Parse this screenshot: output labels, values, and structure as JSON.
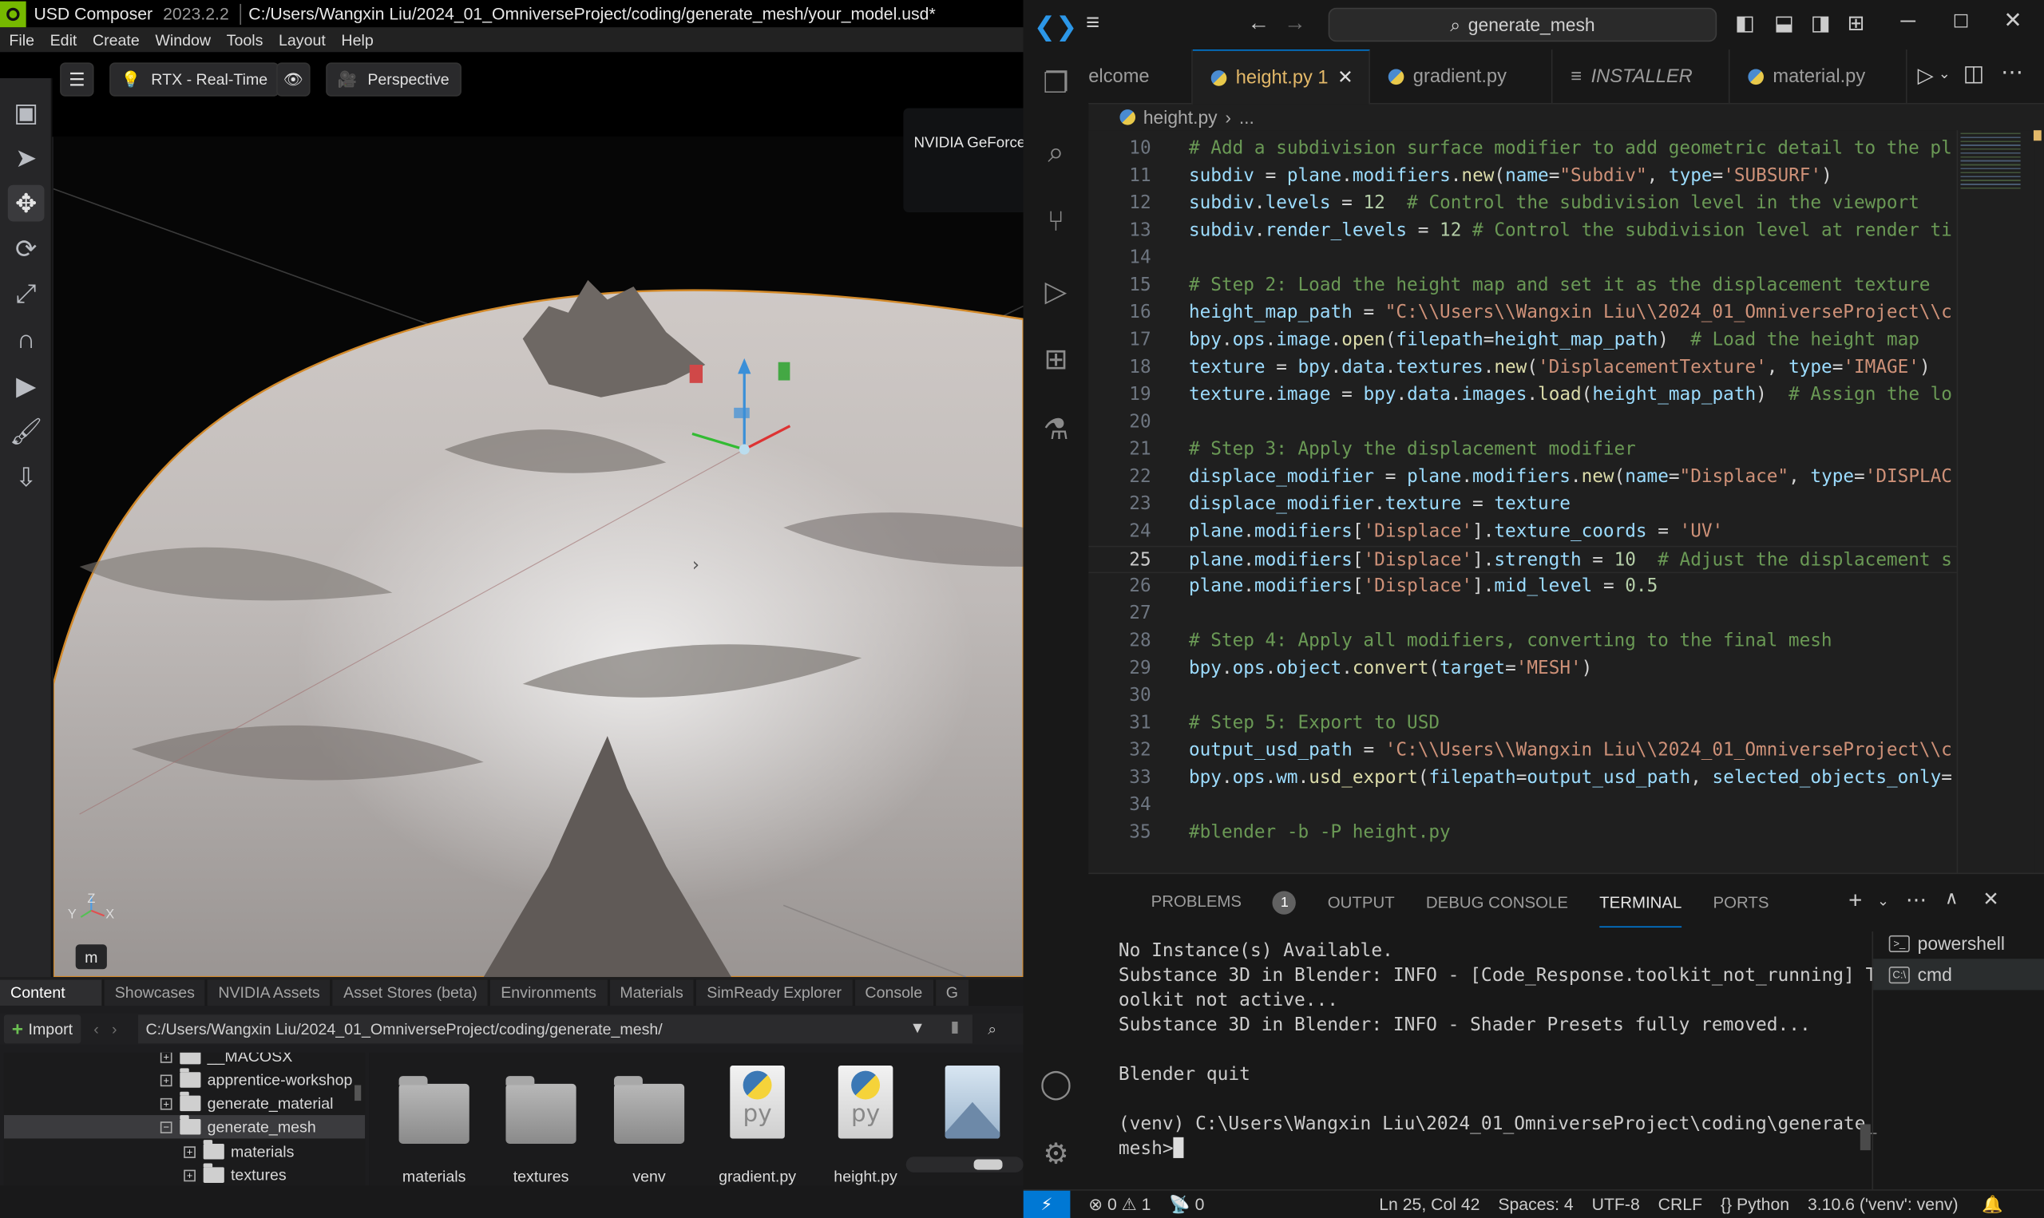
{
  "usd": {
    "app_name": "USD Composer",
    "version": "2023.2.2",
    "file_path": "C:/Users/Wangxin Liu/2024_01_OmniverseProject/coding/generate_mesh/your_model.usd*",
    "menu": [
      "File",
      "Edit",
      "Create",
      "Window",
      "Tools",
      "Layout",
      "Help"
    ],
    "viewport": {
      "render_mode": "RTX - Real-Time",
      "camera": "Perspective",
      "gpu_label": "NVIDIA GeForce",
      "axis_labels": {
        "y": "Y",
        "z": "Z",
        "x": "X"
      },
      "m_button": "m"
    },
    "content_tabs": [
      "Content",
      "Showcases",
      "NVIDIA Assets",
      "Asset Stores (beta)",
      "Environments",
      "Materials",
      "SimReady Explorer",
      "Console",
      "G"
    ],
    "import_label": "Import",
    "content_path": "C:/Users/Wangxin Liu/2024_01_OmniverseProject/coding/generate_mesh/",
    "tree": [
      {
        "label": "__MACOSX",
        "level": 1
      },
      {
        "label": "apprentice-workshop",
        "level": 1
      },
      {
        "label": "generate_material",
        "level": 1
      },
      {
        "label": "generate_mesh",
        "level": 1,
        "selected": true,
        "expanded": true
      },
      {
        "label": "materials",
        "level": 2
      },
      {
        "label": "textures",
        "level": 2
      }
    ],
    "files": [
      {
        "name": "materials",
        "kind": "folder"
      },
      {
        "name": "textures",
        "kind": "folder"
      },
      {
        "name": "venv",
        "kind": "folder"
      },
      {
        "name": "gradient.py",
        "kind": "python"
      },
      {
        "name": "height.py",
        "kind": "python"
      },
      {
        "name": "",
        "kind": "image"
      }
    ],
    "py_glyph": "py"
  },
  "vscode": {
    "search": "generate_mesh",
    "tabs": [
      {
        "label": "elcome",
        "kind": "welcome"
      },
      {
        "label": "height.py",
        "kind": "python",
        "active": true,
        "problems": "1"
      },
      {
        "label": "gradient.py",
        "kind": "python"
      },
      {
        "label": "INSTALLER",
        "kind": "text"
      },
      {
        "label": "material.py",
        "kind": "python"
      }
    ],
    "breadcrumb": {
      "file": "height.py",
      "rest": "..."
    },
    "current_line": 25,
    "code": [
      {
        "n": "10",
        "t": [
          [
            "cmt",
            "# Add a subdivision surface modifier to add geometric detail to the pl"
          ]
        ]
      },
      {
        "n": "11",
        "t": [
          [
            "var",
            "subdiv"
          ],
          [
            "op",
            " = "
          ],
          [
            "var",
            "plane"
          ],
          [
            "op",
            "."
          ],
          [
            "var",
            "modifiers"
          ],
          [
            "op",
            "."
          ],
          [
            "fn",
            "new"
          ],
          [
            "op",
            "("
          ],
          [
            "var",
            "name"
          ],
          [
            "op",
            "="
          ],
          [
            "str",
            "\"Subdiv\""
          ],
          [
            "op",
            ", "
          ],
          [
            "var",
            "type"
          ],
          [
            "op",
            "="
          ],
          [
            "str",
            "'SUBSURF'"
          ],
          [
            "op",
            ")"
          ]
        ]
      },
      {
        "n": "12",
        "t": [
          [
            "var",
            "subdiv"
          ],
          [
            "op",
            "."
          ],
          [
            "var",
            "levels"
          ],
          [
            "op",
            " = "
          ],
          [
            "num",
            "12"
          ],
          [
            "op",
            "  "
          ],
          [
            "cmt",
            "# Control the subdivision level in the viewport"
          ]
        ]
      },
      {
        "n": "13",
        "t": [
          [
            "var",
            "subdiv"
          ],
          [
            "op",
            "."
          ],
          [
            "var",
            "render_levels"
          ],
          [
            "op",
            " = "
          ],
          [
            "num",
            "12"
          ],
          [
            "op",
            " "
          ],
          [
            "cmt",
            "# Control the subdivision level at render ti"
          ]
        ]
      },
      {
        "n": "14",
        "t": []
      },
      {
        "n": "15",
        "t": [
          [
            "cmt",
            "# Step 2: Load the height map and set it as the displacement texture"
          ]
        ]
      },
      {
        "n": "16",
        "t": [
          [
            "var",
            "height_map_path"
          ],
          [
            "op",
            " = "
          ],
          [
            "str",
            "\"C:\\\\Users\\\\Wangxin Liu\\\\2024_01_OmniverseProject\\\\c"
          ]
        ]
      },
      {
        "n": "17",
        "t": [
          [
            "var",
            "bpy"
          ],
          [
            "op",
            "."
          ],
          [
            "var",
            "ops"
          ],
          [
            "op",
            "."
          ],
          [
            "var",
            "image"
          ],
          [
            "op",
            "."
          ],
          [
            "fn",
            "open"
          ],
          [
            "op",
            "("
          ],
          [
            "var",
            "filepath"
          ],
          [
            "op",
            "="
          ],
          [
            "var",
            "height_map_path"
          ],
          [
            "op",
            ")  "
          ],
          [
            "cmt",
            "# Load the height map"
          ]
        ]
      },
      {
        "n": "18",
        "t": [
          [
            "var",
            "texture"
          ],
          [
            "op",
            " = "
          ],
          [
            "var",
            "bpy"
          ],
          [
            "op",
            "."
          ],
          [
            "var",
            "data"
          ],
          [
            "op",
            "."
          ],
          [
            "var",
            "textures"
          ],
          [
            "op",
            "."
          ],
          [
            "fn",
            "new"
          ],
          [
            "op",
            "("
          ],
          [
            "str",
            "'DisplacementTexture'"
          ],
          [
            "op",
            ", "
          ],
          [
            "var",
            "type"
          ],
          [
            "op",
            "="
          ],
          [
            "str",
            "'IMAGE'"
          ],
          [
            "op",
            ")"
          ]
        ]
      },
      {
        "n": "19",
        "t": [
          [
            "var",
            "texture"
          ],
          [
            "op",
            "."
          ],
          [
            "var",
            "image"
          ],
          [
            "op",
            " = "
          ],
          [
            "var",
            "bpy"
          ],
          [
            "op",
            "."
          ],
          [
            "var",
            "data"
          ],
          [
            "op",
            "."
          ],
          [
            "var",
            "images"
          ],
          [
            "op",
            "."
          ],
          [
            "fn",
            "load"
          ],
          [
            "op",
            "("
          ],
          [
            "var",
            "height_map_path"
          ],
          [
            "op",
            ")  "
          ],
          [
            "cmt",
            "# Assign the lo"
          ]
        ]
      },
      {
        "n": "20",
        "t": []
      },
      {
        "n": "21",
        "t": [
          [
            "cmt",
            "# Step 3: Apply the displacement modifier"
          ]
        ]
      },
      {
        "n": "22",
        "t": [
          [
            "var",
            "displace_modifier"
          ],
          [
            "op",
            " = "
          ],
          [
            "var",
            "plane"
          ],
          [
            "op",
            "."
          ],
          [
            "var",
            "modifiers"
          ],
          [
            "op",
            "."
          ],
          [
            "fn",
            "new"
          ],
          [
            "op",
            "("
          ],
          [
            "var",
            "name"
          ],
          [
            "op",
            "="
          ],
          [
            "str",
            "\"Displace\""
          ],
          [
            "op",
            ", "
          ],
          [
            "var",
            "type"
          ],
          [
            "op",
            "="
          ],
          [
            "str",
            "'DISPLAC"
          ]
        ]
      },
      {
        "n": "23",
        "t": [
          [
            "var",
            "displace_modifier"
          ],
          [
            "op",
            "."
          ],
          [
            "var",
            "texture"
          ],
          [
            "op",
            " = "
          ],
          [
            "var",
            "texture"
          ]
        ]
      },
      {
        "n": "24",
        "t": [
          [
            "var",
            "plane"
          ],
          [
            "op",
            "."
          ],
          [
            "var",
            "modifiers"
          ],
          [
            "op",
            "["
          ],
          [
            "str",
            "'Displace'"
          ],
          [
            "op",
            "]."
          ],
          [
            "var",
            "texture_coords"
          ],
          [
            "op",
            " = "
          ],
          [
            "str",
            "'UV'"
          ]
        ]
      },
      {
        "n": "25",
        "t": [
          [
            "var",
            "plane"
          ],
          [
            "op",
            "."
          ],
          [
            "var",
            "modifiers"
          ],
          [
            "op",
            "["
          ],
          [
            "str",
            "'Displace'"
          ],
          [
            "op",
            "]."
          ],
          [
            "var",
            "strength"
          ],
          [
            "op",
            " = "
          ],
          [
            "num",
            "10"
          ],
          [
            "op",
            "  "
          ],
          [
            "cmt",
            "# Adjust the displacement s"
          ]
        ]
      },
      {
        "n": "26",
        "t": [
          [
            "var",
            "plane"
          ],
          [
            "op",
            "."
          ],
          [
            "var",
            "modifiers"
          ],
          [
            "op",
            "["
          ],
          [
            "str",
            "'Displace'"
          ],
          [
            "op",
            "]."
          ],
          [
            "var",
            "mid_level"
          ],
          [
            "op",
            " = "
          ],
          [
            "num",
            "0.5"
          ]
        ]
      },
      {
        "n": "27",
        "t": []
      },
      {
        "n": "28",
        "t": [
          [
            "cmt",
            "# Step 4: Apply all modifiers, converting to the final mesh"
          ]
        ]
      },
      {
        "n": "29",
        "t": [
          [
            "var",
            "bpy"
          ],
          [
            "op",
            "."
          ],
          [
            "var",
            "ops"
          ],
          [
            "op",
            "."
          ],
          [
            "var",
            "object"
          ],
          [
            "op",
            "."
          ],
          [
            "fn",
            "convert"
          ],
          [
            "op",
            "("
          ],
          [
            "var",
            "target"
          ],
          [
            "op",
            "="
          ],
          [
            "str",
            "'MESH'"
          ],
          [
            "op",
            ")"
          ]
        ]
      },
      {
        "n": "30",
        "t": []
      },
      {
        "n": "31",
        "t": [
          [
            "cmt",
            "# Step 5: Export to USD"
          ]
        ]
      },
      {
        "n": "32",
        "t": [
          [
            "var",
            "output_usd_path"
          ],
          [
            "op",
            " = "
          ],
          [
            "str",
            "'C:\\\\Users\\\\Wangxin Liu\\\\2024_01_OmniverseProject\\\\c"
          ]
        ]
      },
      {
        "n": "33",
        "t": [
          [
            "var",
            "bpy"
          ],
          [
            "op",
            "."
          ],
          [
            "var",
            "ops"
          ],
          [
            "op",
            "."
          ],
          [
            "var",
            "wm"
          ],
          [
            "op",
            "."
          ],
          [
            "fn",
            "usd_export"
          ],
          [
            "op",
            "("
          ],
          [
            "var",
            "filepath"
          ],
          [
            "op",
            "="
          ],
          [
            "var",
            "output_usd_path"
          ],
          [
            "op",
            ", "
          ],
          [
            "var",
            "selected_objects_only"
          ],
          [
            "op",
            "="
          ]
        ]
      },
      {
        "n": "34",
        "t": []
      },
      {
        "n": "35",
        "t": [
          [
            "cmt",
            "#blender -b -P height.py"
          ]
        ]
      }
    ],
    "panel_tabs": [
      "PROBLEMS",
      "OUTPUT",
      "DEBUG CONSOLE",
      "TERMINAL",
      "PORTS"
    ],
    "active_panel": "TERMINAL",
    "problems_count": "1",
    "terminal_lines": [
      "No Instance(s) Available.",
      "Substance 3D in Blender: INFO - [Code_Response.toolkit_not_running] T",
      "oolkit not active...",
      "Substance 3D in Blender: INFO - Shader Presets fully removed...",
      "",
      "Blender quit",
      "",
      "(venv) C:\\Users\\Wangxin Liu\\2024_01_OmniverseProject\\coding\\generate_",
      "mesh>"
    ],
    "terminals": [
      {
        "label": "powershell",
        "selected": false
      },
      {
        "label": "cmd",
        "selected": true
      }
    ],
    "status": {
      "errors": "0",
      "warnings": "1",
      "ports": "0",
      "position": "Ln 25, Col 42",
      "spaces": "Spaces: 4",
      "encoding": "UTF-8",
      "eol": "CRLF",
      "language": "Python",
      "interpreter": "3.10.6 ('venv': venv)"
    }
  }
}
